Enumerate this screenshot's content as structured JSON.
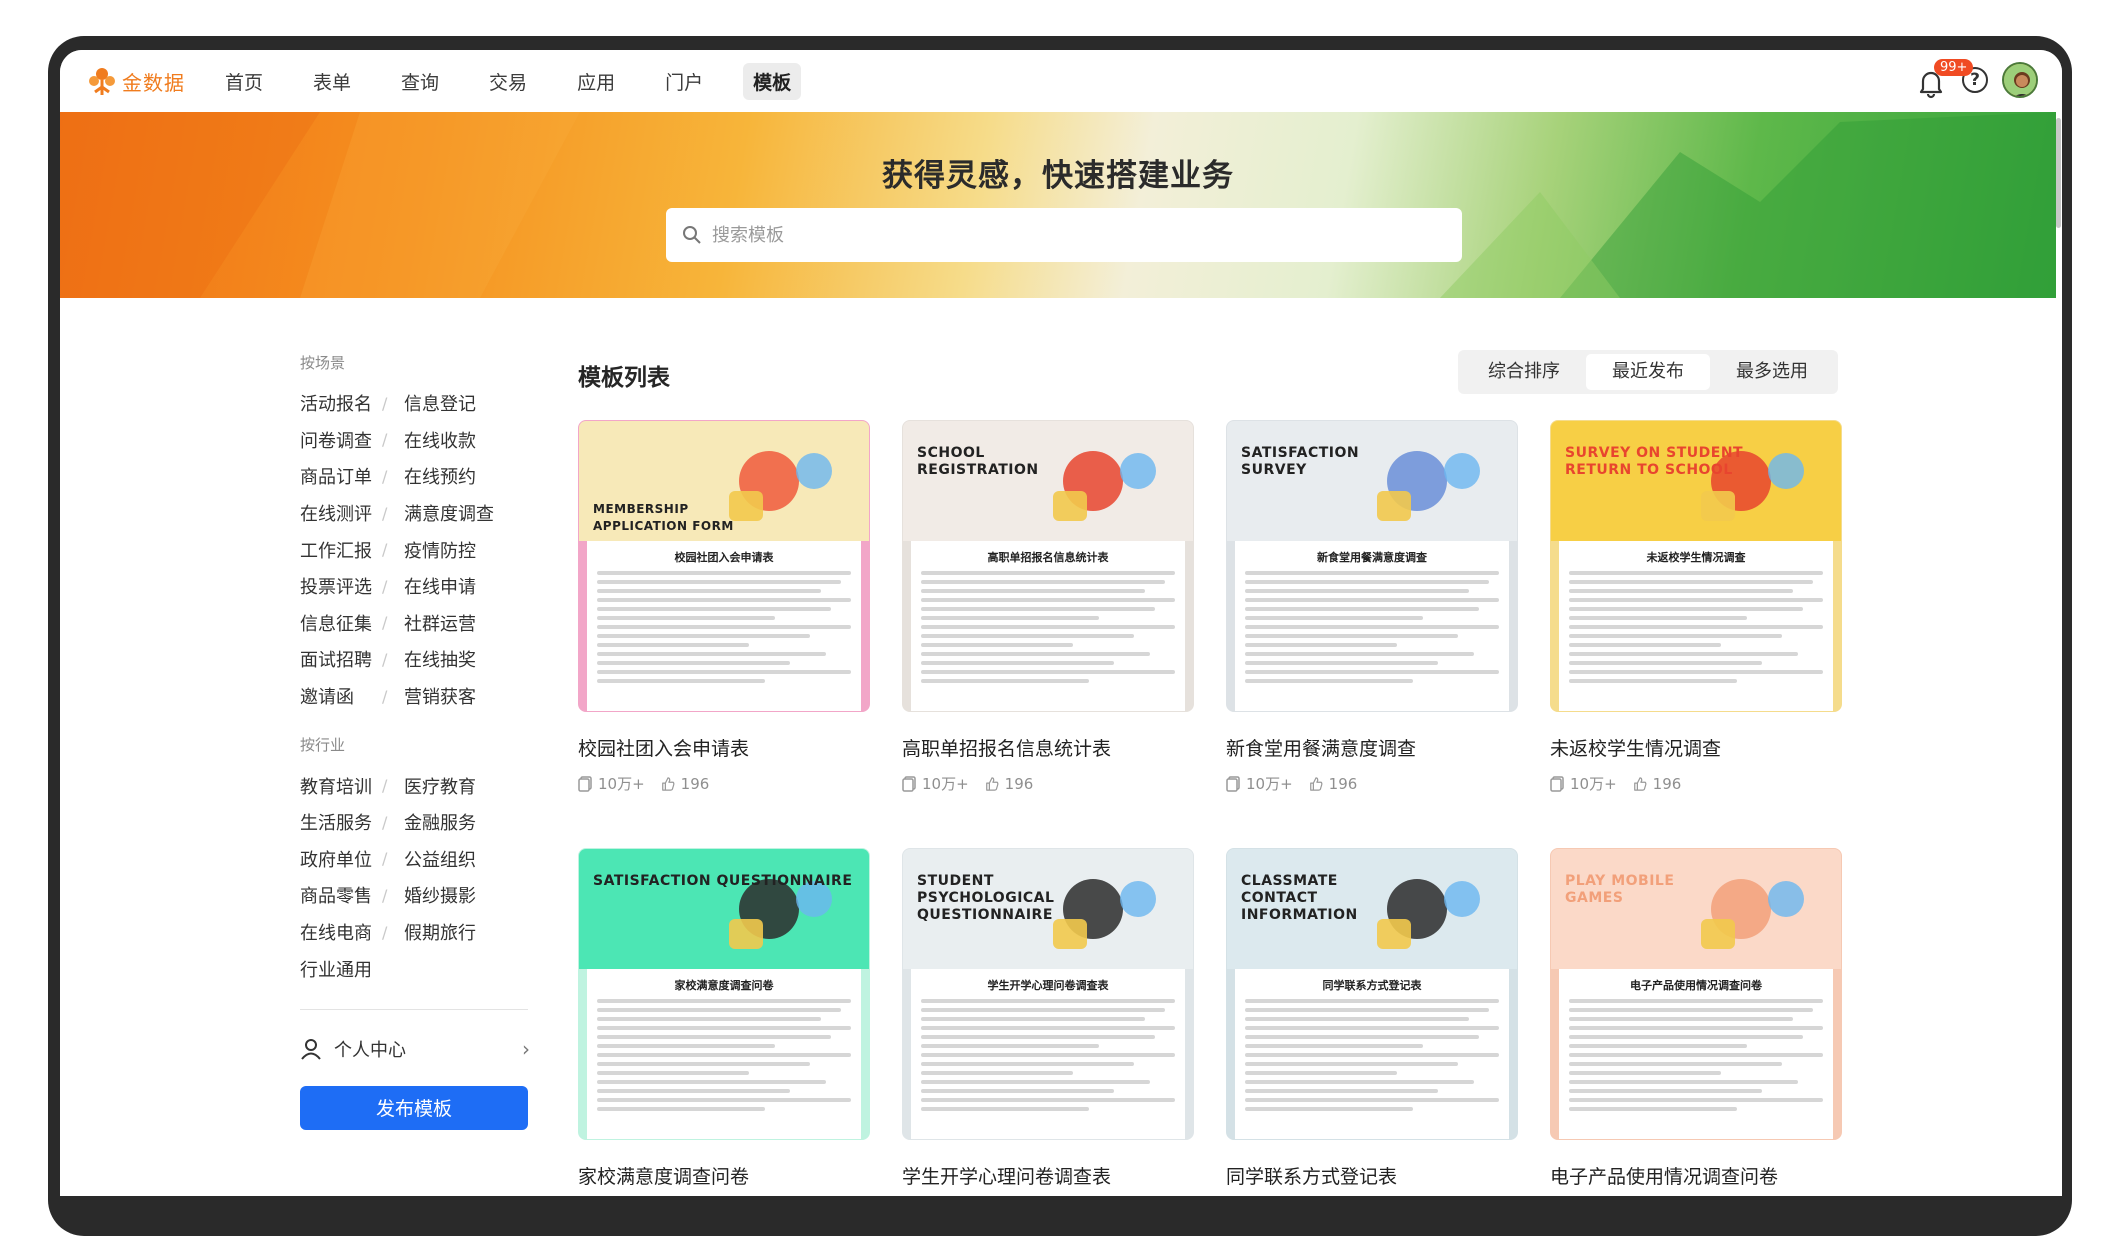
{
  "app": {
    "name": "金数据"
  },
  "nav": {
    "items": [
      "首页",
      "表单",
      "查询",
      "交易",
      "应用",
      "门户",
      "模板"
    ],
    "active_index": 6
  },
  "notifications": {
    "badge": "99+"
  },
  "banner": {
    "title": "获得灵感，快速搭建业务",
    "search_placeholder": "搜索模板"
  },
  "sidebar": {
    "scene_heading": "按场景",
    "scene_rows": [
      [
        "活动报名",
        "信息登记"
      ],
      [
        "问卷调查",
        "在线收款"
      ],
      [
        "商品订单",
        "在线预约"
      ],
      [
        "在线测评",
        "满意度调查"
      ],
      [
        "工作汇报",
        "疫情防控"
      ],
      [
        "投票评选",
        "在线申请"
      ],
      [
        "信息征集",
        "社群运营"
      ],
      [
        "面试招聘",
        "在线抽奖"
      ],
      [
        "邀请函",
        "营销获客"
      ]
    ],
    "industry_heading": "按行业",
    "industry_rows": [
      [
        "教育培训",
        "医疗教育"
      ],
      [
        "生活服务",
        "金融服务"
      ],
      [
        "政府单位",
        "公益组织"
      ],
      [
        "商品零售",
        "婚纱摄影"
      ],
      [
        "在线电商",
        "假期旅行"
      ],
      [
        "行业通用",
        ""
      ]
    ],
    "personal_center": "个人中心",
    "publish_button": "发布模板"
  },
  "main": {
    "title": "模板列表",
    "sort_options": [
      "综合排序",
      "最近发布",
      "最多选用"
    ],
    "sort_active_index": 1
  },
  "cards": [
    {
      "title": "校园社团入会申请表",
      "uses": "10万+",
      "likes": "196",
      "cover_text": "MEMBERSHIP\nAPPLICATION FORM",
      "doc_title": "校园社团入会申请表",
      "cover_color": "#f7e9b8",
      "border_color": "#f2a6c8",
      "accent": "#f05a3c"
    },
    {
      "title": "高职单招报名信息统计表",
      "uses": "10万+",
      "likes": "196",
      "cover_text": "SCHOOL\nREGISTRATION",
      "doc_title": "高职单招报名信息统计表",
      "cover_color": "#f1ebe6",
      "border_color": "#e6e1dc",
      "accent": "#e8452e"
    },
    {
      "title": "新食堂用餐满意度调查",
      "uses": "10万+",
      "likes": "196",
      "cover_text": "SATISFACTION\nSURVEY",
      "doc_title": "新食堂用餐满意度调查",
      "cover_color": "#e8ecef",
      "border_color": "#dde2e6",
      "accent": "#6a8fd8"
    },
    {
      "title": "未返校学生情况调查",
      "uses": "10万+",
      "likes": "196",
      "cover_text": "SURVEY ON STUDENT\nRETURN TO SCHOOL",
      "doc_title": "未返校学生情况调查",
      "cover_color": "#f7cf45",
      "border_color": "#f5dc8c",
      "accent": "#e8452e"
    },
    {
      "title": "家校满意度调查问卷",
      "uses": "",
      "likes": "",
      "cover_text": "SATISFACTION QUESTIONNAIRE",
      "doc_title": "家校满意度调查问卷",
      "cover_color": "#4ce6b4",
      "border_color": "#bff3e0",
      "accent": "#2b2b2b"
    },
    {
      "title": "学生开学心理问卷调查表",
      "uses": "",
      "likes": "",
      "cover_text": "STUDENT\nPSYCHOLOGICAL\nQUESTIONNAIRE",
      "doc_title": "学生开学心理问卷调查表",
      "cover_color": "#e9eef0",
      "border_color": "#dfe5e8",
      "accent": "#2b2b2b"
    },
    {
      "title": "同学联系方式登记表",
      "uses": "",
      "likes": "",
      "cover_text": "CLASSMATE\nCONTACT\nINFORMATION",
      "doc_title": "同学联系方式登记表",
      "cover_color": "#dce9ee",
      "border_color": "#d4e1e6",
      "accent": "#2b2b2b"
    },
    {
      "title": "电子产品使用情况调查问卷",
      "uses": "",
      "likes": "",
      "cover_text": "PLAY MOBILE\nGAMES",
      "doc_title": "电子产品使用情况调查问卷",
      "cover_color": "#fbd9c8",
      "border_color": "#f6c9b3",
      "accent": "#f2a07a"
    }
  ]
}
